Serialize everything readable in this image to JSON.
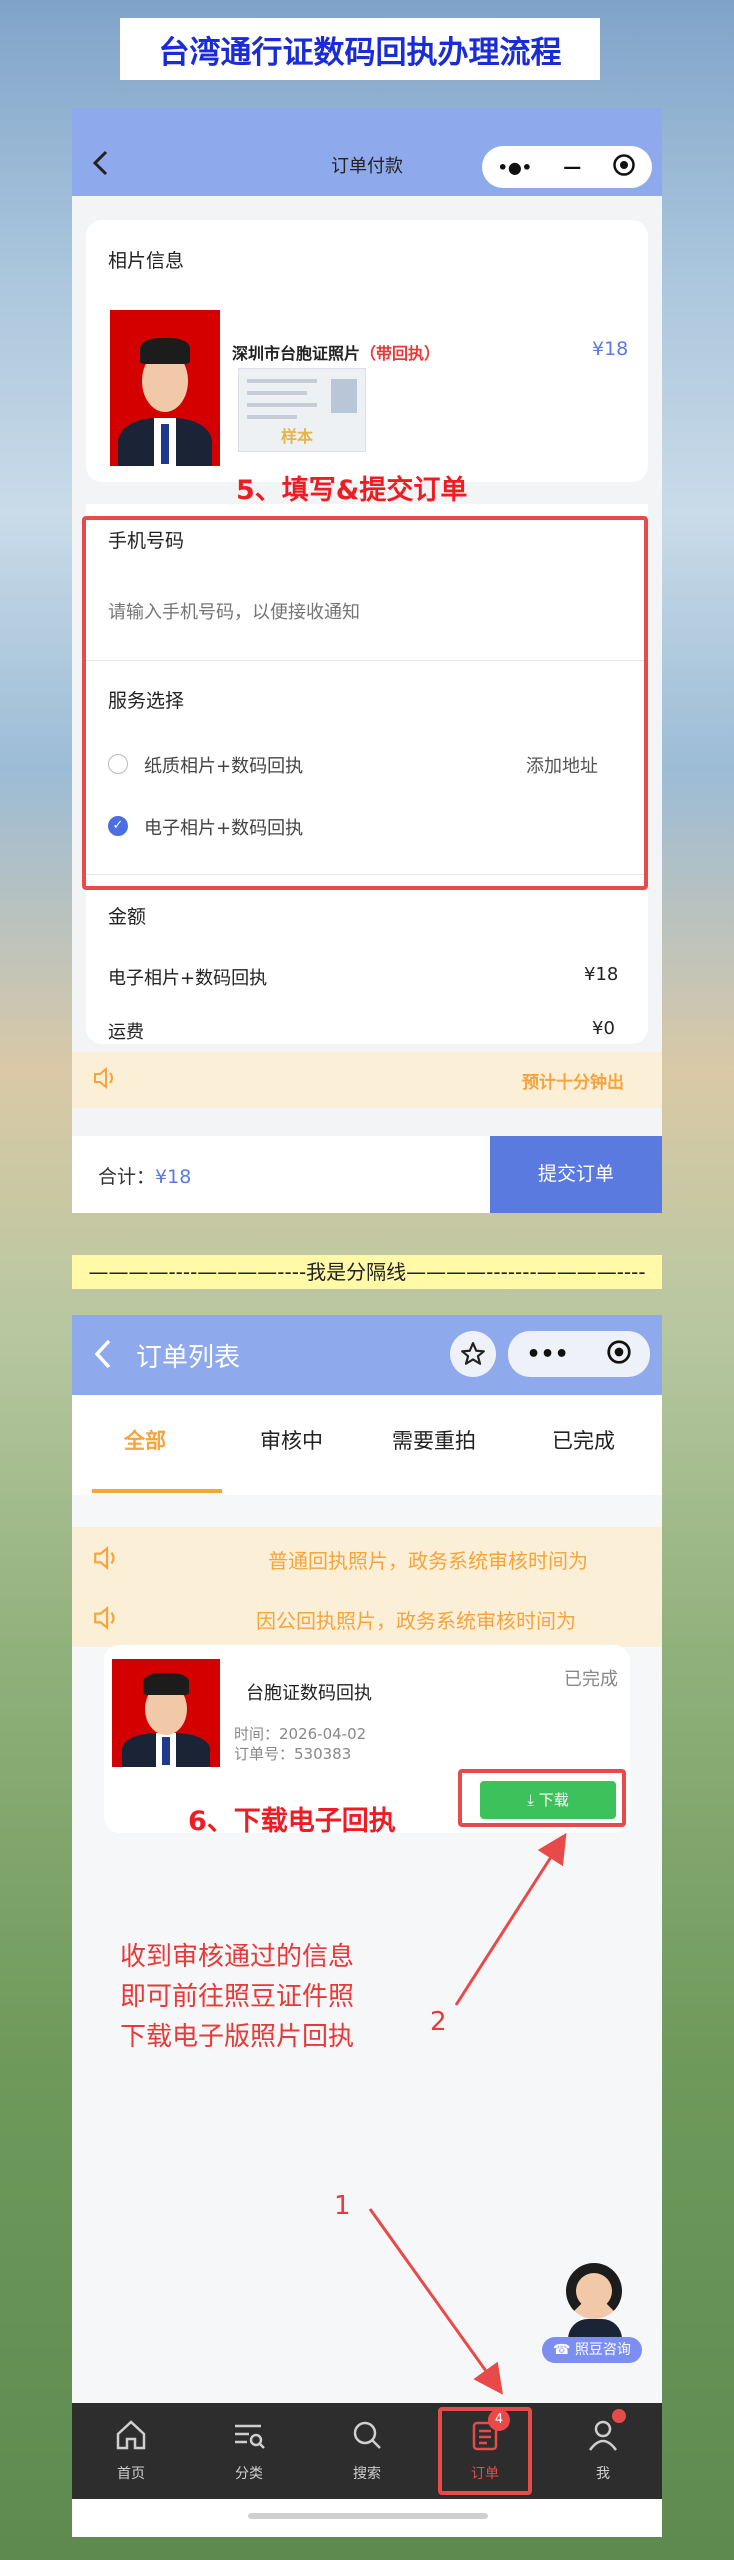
{
  "banner": {
    "title": "台湾通行证数码回执办理流程"
  },
  "order_pay": {
    "title": "订单付款",
    "capsule": {
      "more": "•●•",
      "minimize": "—"
    },
    "photo_section": {
      "heading": "相片信息",
      "product_name": "深圳市台胞证照片（带回执）",
      "product_name_main": "深圳市台胞证照片",
      "product_name_tag": "（带回执）",
      "price": "¥18",
      "sample_label": "样本"
    },
    "step_label": "5、填写&提交订单",
    "phone": {
      "heading": "手机号码",
      "placeholder": "请输入手机号码，以便接收通知"
    },
    "service": {
      "heading": "服务选择",
      "options": [
        {
          "label": "纸质相片+数码回执",
          "selected": false,
          "action": "添加地址"
        },
        {
          "label": "电子相片+数码回执",
          "selected": true,
          "action": ""
        }
      ]
    },
    "amount": {
      "heading": "金额",
      "rows": [
        {
          "label": "电子相片+数码回执",
          "value": "¥18"
        },
        {
          "label": "运费",
          "value": "¥0"
        }
      ]
    },
    "notice": {
      "text": "预计十分钟出"
    },
    "footer": {
      "total_label": "合计：",
      "total_value": "¥18",
      "submit_label": "提交订单"
    }
  },
  "separator": {
    "text": "————----————----我是分隔线————-------————----"
  },
  "order_list": {
    "title": "订单列表",
    "tabs": [
      "全部",
      "审核中",
      "需要重拍",
      "已完成"
    ],
    "active_tab": 0,
    "notices": [
      "普通回执照片，政务系统审核时间为",
      "因公回执照片，政务系统审核时间为"
    ],
    "order": {
      "title": "台胞证数码回执",
      "status": "已完成",
      "time_label": "时间：2026-04-02",
      "order_no_label": "订单号：530383",
      "download_label": "下载"
    },
    "step_label": "6、下载电子回执",
    "annotation_lines": [
      "收到审核通过的信息",
      "即可前往照豆证件照",
      "下载电子版照片回执"
    ],
    "arrow_labels": [
      "2",
      "1"
    ],
    "consult_label": "照豆咨询",
    "nav": [
      {
        "label": "首页",
        "icon": "home-icon"
      },
      {
        "label": "分类",
        "icon": "category-icon"
      },
      {
        "label": "搜索",
        "icon": "search-icon"
      },
      {
        "label": "订单",
        "icon": "order-icon",
        "badge": "4"
      },
      {
        "label": "我",
        "icon": "profile-icon"
      }
    ]
  },
  "colors": {
    "header_blue": "#8ea9ec",
    "accent_red": "#e84a4a",
    "primary_blue": "#5b7ae0",
    "orange": "#f6a43b",
    "download_green": "#3cc25a"
  }
}
